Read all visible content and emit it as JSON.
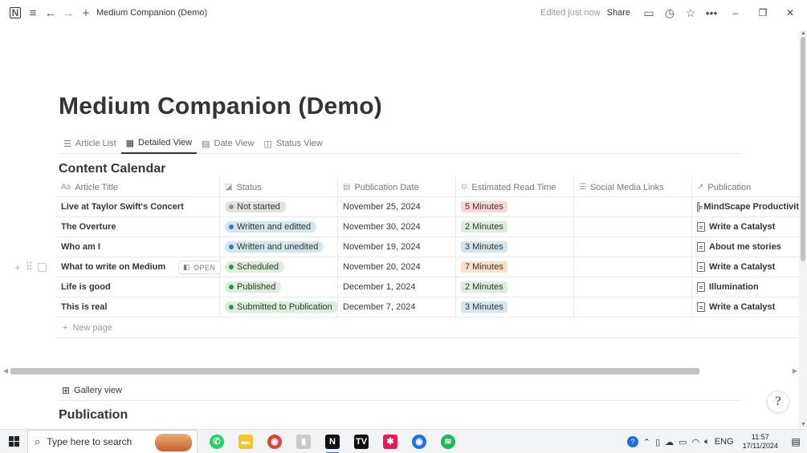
{
  "topbar": {
    "breadcrumb": "Medium Companion (Demo)",
    "edited": "Edited just now",
    "share": "Share",
    "icons": [
      "notion-icon",
      "menu-icon",
      "back-arrow-icon",
      "forward-arrow-icon",
      "plus-icon",
      "comment-icon",
      "clock-icon",
      "star-icon",
      "more-icon"
    ],
    "window_controls": {
      "minimize": "–",
      "restore": "❐",
      "close": "✕"
    }
  },
  "page": {
    "title": "Medium Companion (Demo)",
    "views": [
      {
        "label": "Article List",
        "icon": "list-icon",
        "active": false
      },
      {
        "label": "Detailed View",
        "icon": "table-icon",
        "active": true
      },
      {
        "label": "Date View",
        "icon": "calendar-icon",
        "active": false
      },
      {
        "label": "Status View",
        "icon": "board-icon",
        "active": false
      }
    ],
    "database_title": "Content Calendar",
    "columns": [
      {
        "label": "Article Title",
        "icon": "Aa"
      },
      {
        "label": "Status",
        "icon": "status-icon"
      },
      {
        "label": "Publication Date",
        "icon": "calendar-icon"
      },
      {
        "label": "Estimated Read Time",
        "icon": "select-icon"
      },
      {
        "label": "Social Media Links",
        "icon": "list-icon"
      },
      {
        "label": "Publication",
        "icon": "relation-arrow-icon"
      }
    ],
    "rows": [
      {
        "title": "Live at Taylor Swift's Concert",
        "status": "Not started",
        "date": "November 25, 2024",
        "read_time": "5 Minutes",
        "social": "",
        "publication": "MindScape Productivit"
      },
      {
        "title": "The Overture",
        "status": "Written and editted",
        "date": "November 30, 2024",
        "read_time": "2 Minutes",
        "social": "",
        "publication": "Write a Catalyst"
      },
      {
        "title": "Who am I",
        "status": "Written and unedited",
        "date": "November 19, 2024",
        "read_time": "3 Minutes",
        "social": "",
        "publication": "About me stories"
      },
      {
        "title": "What to write on Medium",
        "status": "Scheduled",
        "date": "November 20, 2024",
        "read_time": "7 Minutes",
        "social": "",
        "publication": "Write a Catalyst"
      },
      {
        "title": "Life is good",
        "status": "Published",
        "date": "December 1, 2024",
        "read_time": "2 Minutes",
        "social": "",
        "publication": "Illumination"
      },
      {
        "title": "This is real",
        "status": "Submitted to Publication",
        "date": "December 7, 2024",
        "read_time": "3 Minutes",
        "social": "",
        "publication": "Write a Catalyst"
      }
    ],
    "open_label": "OPEN",
    "new_page": "New page",
    "gallery_view": "Gallery view",
    "publication_heading": "Publication",
    "help_glyph": "?"
  },
  "colors": {
    "status": {
      "Not started": {
        "bg": "#e3e2e0",
        "dot": "#91918e"
      },
      "Written and editted": {
        "bg": "#d3e5ef",
        "dot": "#337ea9"
      },
      "Written and unedited": {
        "bg": "#d3e5ef",
        "dot": "#337ea9"
      },
      "Scheduled": {
        "bg": "#dbeddb",
        "dot": "#448361"
      },
      "Published": {
        "bg": "#dbeddb",
        "dot": "#448361"
      },
      "Submitted to Publication": {
        "bg": "#dbeddb",
        "dot": "#448361"
      }
    },
    "read_time": {
      "5 Minutes": "#f9d6d8",
      "2 Minutes": "#dbeddb",
      "3 Minutes": "#d3e5ef",
      "7 Minutes": "#fadec9"
    }
  },
  "taskbar": {
    "search_placeholder": "Type here to search",
    "apps": [
      {
        "name": "whatsapp",
        "color": "#25d366",
        "glyph": "✆",
        "active": false
      },
      {
        "name": "file-explorer",
        "color": "#f4c430",
        "glyph": "▬",
        "active": false
      },
      {
        "name": "chrome",
        "color": "#db4437",
        "glyph": "◉",
        "active": false
      },
      {
        "name": "app-bars",
        "color": "#c9c9c9",
        "glyph": "▮",
        "active": false
      },
      {
        "name": "notion",
        "color": "#111111",
        "glyph": "N",
        "active": true
      },
      {
        "name": "twitch-tv",
        "color": "#111111",
        "glyph": "TV",
        "active": false
      },
      {
        "name": "slack",
        "color": "#e01e5a",
        "glyph": "✱",
        "active": false
      },
      {
        "name": "chrome-profile",
        "color": "#1a73e8",
        "glyph": "◉",
        "active": false
      },
      {
        "name": "spotify",
        "color": "#1db954",
        "glyph": "≋",
        "active": false
      }
    ],
    "language": "ENG",
    "time": "11:57",
    "date": "17/11/2024"
  }
}
